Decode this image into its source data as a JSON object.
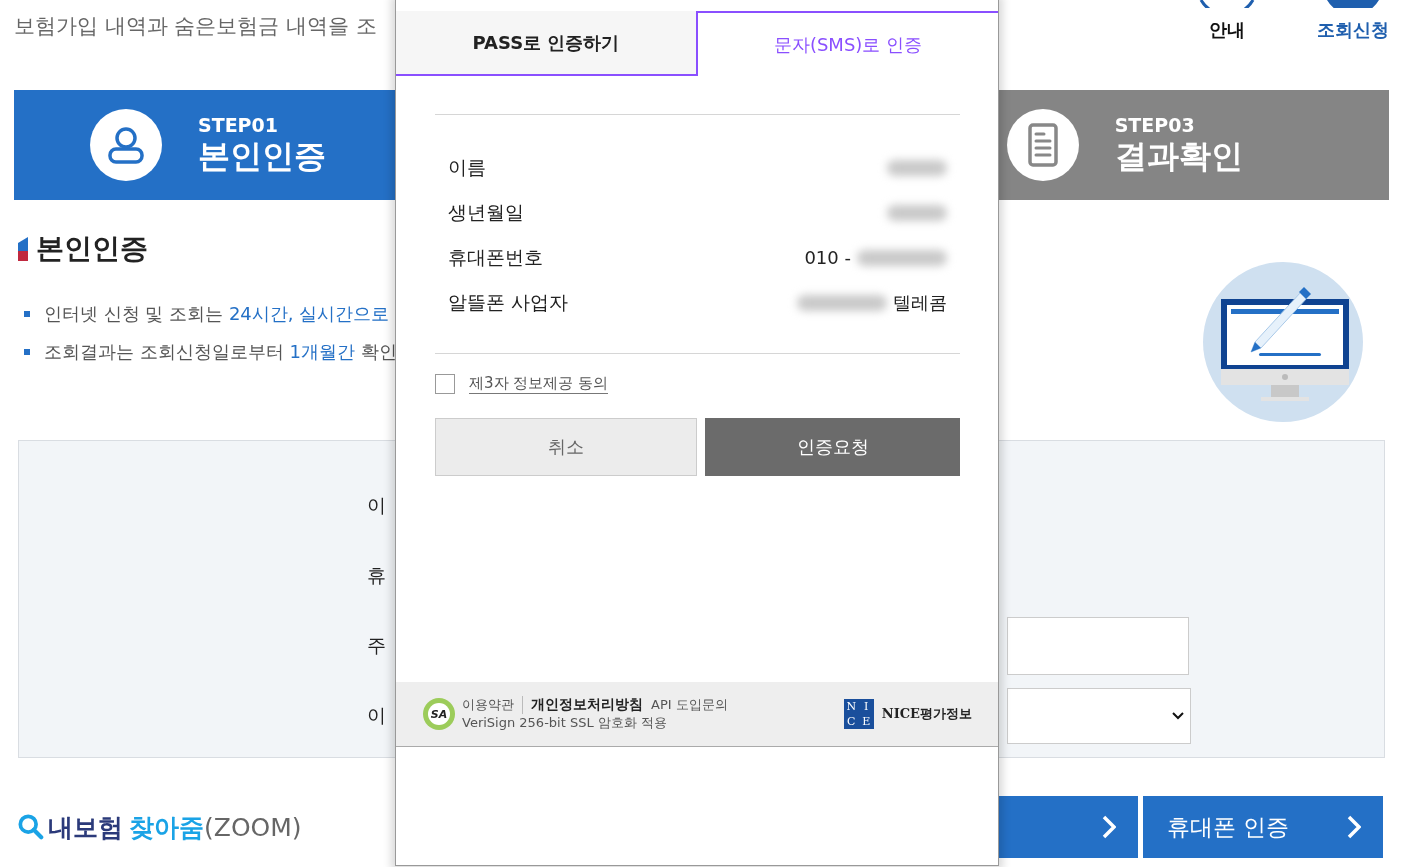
{
  "page": {
    "intro": "보험가입 내역과 숨은보험금 내역을 조",
    "nav": [
      {
        "label": "안내",
        "selected": false
      },
      {
        "label": "조회신청",
        "selected": true
      }
    ],
    "steps": [
      {
        "step": "STEP01",
        "title": "본인인증",
        "selected": true,
        "kind": "person"
      },
      {
        "step": "STEP03",
        "title": "결과확인",
        "selected": false,
        "kind": "document"
      }
    ],
    "section_title": "본인인증",
    "notes": [
      [
        {
          "text": "인터넷 신청 및 조회는 ",
          "highlight": false
        },
        {
          "text": "24시간, 실시간으로",
          "highlight": true
        }
      ],
      [
        {
          "text": "조회결과는 조회신청일로부터 ",
          "highlight": false
        },
        {
          "text": "1개월간",
          "highlight": true
        },
        {
          "text": " 확인",
          "highlight": false
        }
      ]
    ],
    "form_rows": [
      {
        "label": "이",
        "kind": "text"
      },
      {
        "label": "휴",
        "kind": "text"
      },
      {
        "label": "주",
        "kind": "input"
      },
      {
        "label": "이",
        "kind": "select"
      }
    ],
    "brand": {
      "prefix": "내보험",
      "accent": "찾아줌",
      "suffix": "(ZOOM)"
    },
    "buttons": [
      {
        "kind": "arrow"
      },
      {
        "kind": "arrow",
        "label": "휴대폰 인증"
      }
    ]
  },
  "popup": {
    "tabs": [
      {
        "label": "PASS로 인증하기",
        "selected": false
      },
      {
        "label": "문자(SMS)로 인증",
        "selected": true
      }
    ],
    "rows": [
      {
        "label": "이름",
        "kind": "masked"
      },
      {
        "label": "생년월일",
        "kind": "masked"
      },
      {
        "label": "휴대폰번호",
        "value": "010 -",
        "kind": "masked_after"
      },
      {
        "label": "알뜰폰 사업자",
        "value": "텔레콤",
        "kind": "masked_before"
      }
    ],
    "consent": {
      "label": "제3자 정보제공 동의",
      "checked": false
    },
    "actions": [
      {
        "label": "취소",
        "kind": "secondary"
      },
      {
        "label": "인증요청",
        "kind": "primary"
      }
    ],
    "footer": {
      "badge": "SA",
      "links": [
        {
          "label": "이용약관",
          "bold": false
        },
        {
          "label": "개인정보처리방침",
          "bold": true
        },
        {
          "label": "API 도입문의",
          "bold": false
        }
      ],
      "note": "VeriSign 256-bit SSL 암호화 적용",
      "logo_letters": [
        "N",
        "I",
        "C",
        "E"
      ],
      "brand": "NICE평가정보"
    }
  }
}
